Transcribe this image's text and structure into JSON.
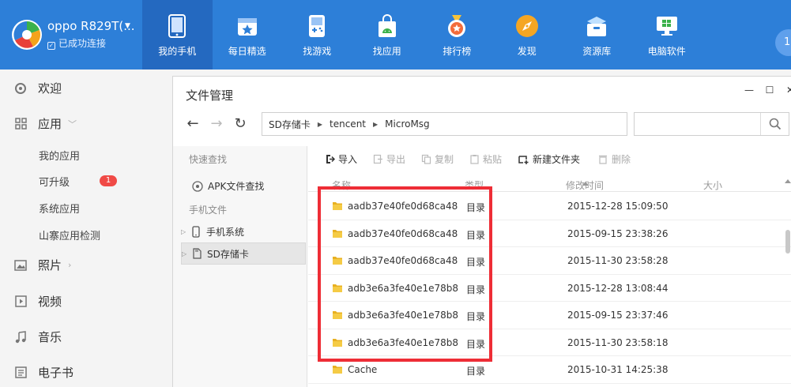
{
  "device": {
    "name": "oppo R829T(...",
    "status": "已成功连接"
  },
  "nav": {
    "items": [
      {
        "label": "我的手机",
        "icon": "phone-icon",
        "active": true
      },
      {
        "label": "每日精选",
        "icon": "calendar-star-icon",
        "active": false
      },
      {
        "label": "找游戏",
        "icon": "gamepad-icon",
        "active": false
      },
      {
        "label": "找应用",
        "icon": "android-bag-icon",
        "active": false
      },
      {
        "label": "排行榜",
        "icon": "medal-icon",
        "active": false
      },
      {
        "label": "发现",
        "icon": "compass-icon",
        "active": false
      },
      {
        "label": "资源库",
        "icon": "box-icon",
        "active": false
      },
      {
        "label": "电脑软件",
        "icon": "monitor-icon",
        "active": false
      }
    ],
    "user_avatar": "1"
  },
  "sidebar": {
    "welcome": "欢迎",
    "apps": "应用",
    "my_apps": "我的应用",
    "upgradable": "可升级",
    "upgradable_count": "1",
    "system_apps": "系统应用",
    "fake_app_check": "山寨应用检测",
    "photos": "照片",
    "video": "视频",
    "music": "音乐",
    "ebook": "电子书"
  },
  "window": {
    "title": "文件管理",
    "minimize": "—",
    "maximize": "☐",
    "close": "✕"
  },
  "address": {
    "parts": [
      "SD存储卡",
      "tencent",
      "MicroMsg"
    ],
    "search_placeholder": ""
  },
  "left_pane": {
    "quick_find": "快速查找",
    "apk_find": "APK文件查找",
    "phone_files": "手机文件",
    "phone_system": "手机系统",
    "sd_card": "SD存储卡"
  },
  "toolbar": {
    "import": "导入",
    "export": "导出",
    "copy": "复制",
    "paste": "粘贴",
    "new_folder": "新建文件夹",
    "delete": "删除"
  },
  "table": {
    "headers": {
      "name": "名称",
      "type": "类型",
      "modified": "修改时间",
      "size": "大小"
    },
    "rows": [
      {
        "name": "aadb37e40fe0d68ca48",
        "type": "目录",
        "modified": "2015-12-28 15:09:50"
      },
      {
        "name": "aadb37e40fe0d68ca48",
        "type": "目录",
        "modified": "2015-09-15 23:38:26"
      },
      {
        "name": "aadb37e40fe0d68ca48",
        "type": "目录",
        "modified": "2015-11-30 23:58:28"
      },
      {
        "name": "adb3e6a3fe40e1e78b8",
        "type": "目录",
        "modified": "2015-12-28 13:08:44"
      },
      {
        "name": "adb3e6a3fe40e1e78b8",
        "type": "目录",
        "modified": "2015-09-15 23:37:46"
      },
      {
        "name": "adb3e6a3fe40e1e78b8",
        "type": "目录",
        "modified": "2015-11-30 23:58:18"
      },
      {
        "name": "Cache",
        "type": "目录",
        "modified": "2015-10-31 14:25:38"
      }
    ]
  },
  "colors": {
    "topbar": "#2d7fd8",
    "active_nav": "#2469c0",
    "highlight": "#ee2d36",
    "badge": "#f04a46"
  }
}
